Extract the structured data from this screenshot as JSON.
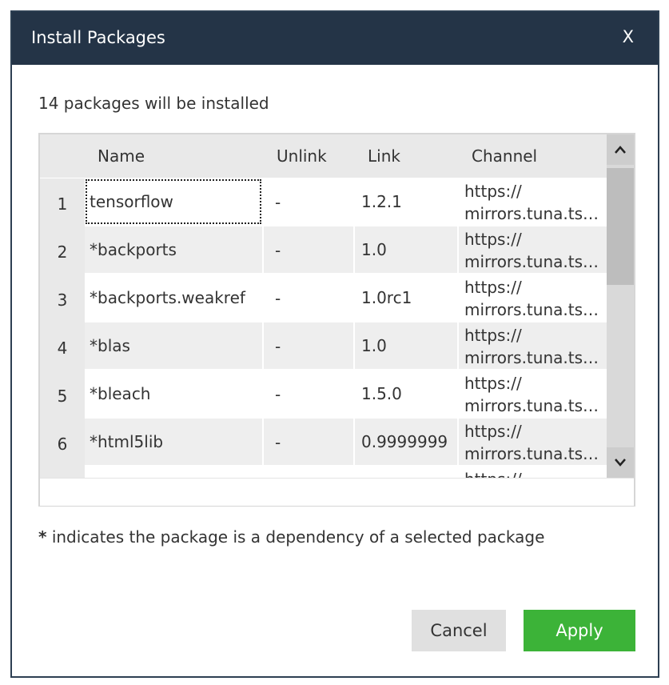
{
  "dialog": {
    "title": "Install Packages",
    "close_label": "X",
    "summary": "14 packages will be installed",
    "note_star": "*",
    "note_text": " indicates the package is a dependency of a selected package",
    "cancel_label": "Cancel",
    "apply_label": "Apply"
  },
  "table": {
    "headers": {
      "name": "Name",
      "unlink": "Unlink",
      "link": "Link",
      "channel": "Channel"
    },
    "rows": [
      {
        "num": "1",
        "name": "tensorflow",
        "unlink": "-",
        "link": "1.2.1",
        "channel1": "https://",
        "channel2": "mirrors.tuna.ts…"
      },
      {
        "num": "2",
        "name": "*backports",
        "unlink": "-",
        "link": "1.0",
        "channel1": "https://",
        "channel2": "mirrors.tuna.ts…"
      },
      {
        "num": "3",
        "name": "*backports.weakref",
        "unlink": "-",
        "link": "1.0rc1",
        "channel1": "https://",
        "channel2": "mirrors.tuna.ts…"
      },
      {
        "num": "4",
        "name": "*blas",
        "unlink": "-",
        "link": "1.0",
        "channel1": "https://",
        "channel2": "mirrors.tuna.ts…"
      },
      {
        "num": "5",
        "name": "*bleach",
        "unlink": "-",
        "link": "1.5.0",
        "channel1": "https://",
        "channel2": "mirrors.tuna.ts…"
      },
      {
        "num": "6",
        "name": "*html5lib",
        "unlink": "-",
        "link": "0.9999999",
        "channel1": "https://",
        "channel2": "mirrors.tuna.ts…"
      },
      {
        "num": "",
        "name": "",
        "unlink": "",
        "link": "",
        "channel1": "https://",
        "channel2": ""
      }
    ]
  },
  "colors": {
    "titlebar": "#243447",
    "apply": "#3cb338",
    "cancel": "#e0e0e0"
  }
}
